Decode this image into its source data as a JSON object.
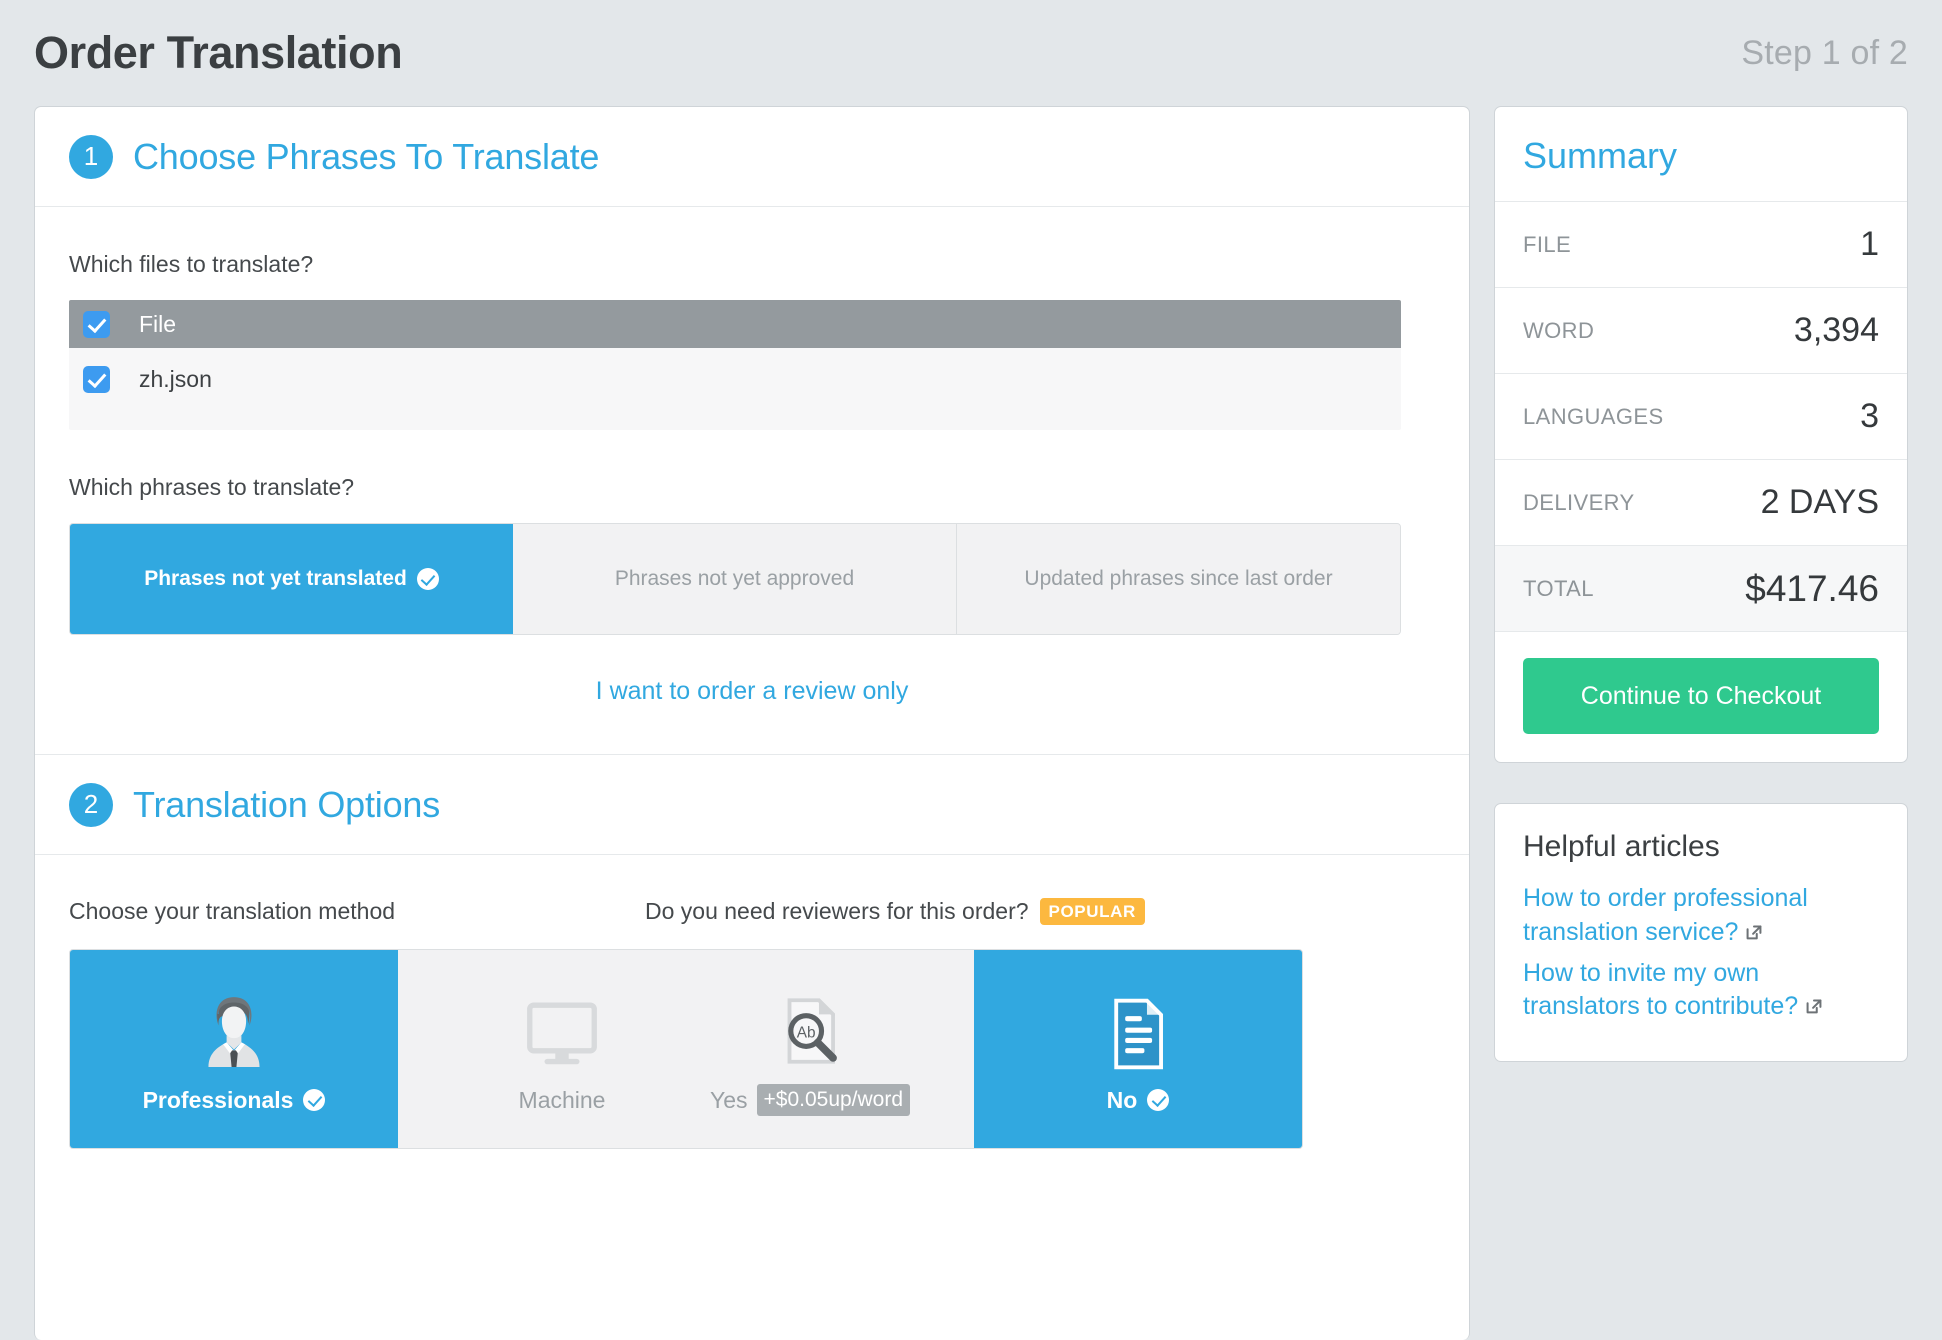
{
  "header": {
    "title": "Order Translation",
    "step": "Step 1 of 2"
  },
  "section1": {
    "number": "1",
    "title": "Choose Phrases To Translate",
    "files_label": "Which files to translate?",
    "file_list": {
      "header": "File",
      "items": [
        "zh.json"
      ]
    },
    "phrases_label": "Which phrases to translate?",
    "phrase_tabs": [
      {
        "label": "Phrases not yet translated",
        "selected": true
      },
      {
        "label": "Phrases not yet approved",
        "selected": false
      },
      {
        "label": "Updated phrases since last order",
        "selected": false
      }
    ],
    "review_link": "I want to order a review only"
  },
  "section2": {
    "number": "2",
    "title": "Translation Options",
    "method_question": "Choose your translation method",
    "method_tiles": [
      {
        "label": "Professionals",
        "icon": "businessperson-icon",
        "selected": true
      },
      {
        "label": "Machine",
        "icon": "monitor-icon",
        "selected": false
      }
    ],
    "reviewer_question": "Do you need reviewers for this order?",
    "reviewer_badge": "POPULAR",
    "reviewer_tiles": [
      {
        "label": "Yes",
        "price": "+$0.05up/word",
        "icon": "document-search-icon",
        "selected": false
      },
      {
        "label": "No",
        "price": "",
        "icon": "document-lines-icon",
        "selected": true
      }
    ]
  },
  "summary": {
    "title": "Summary",
    "rows": [
      {
        "key": "FILE",
        "value": "1"
      },
      {
        "key": "WORD",
        "value": "3,394"
      },
      {
        "key": "LANGUAGES",
        "value": "3"
      },
      {
        "key": "DELIVERY",
        "value": "2 DAYS"
      },
      {
        "key": "TOTAL",
        "value": "$417.46"
      }
    ],
    "checkout_label": "Continue to Checkout"
  },
  "articles": {
    "title": "Helpful articles",
    "links": [
      "How to order professional translation service?",
      "How to invite my own translators to contribute?"
    ]
  },
  "colors": {
    "accent_blue": "#31a8e0",
    "green": "#2fc98e",
    "orange": "#fcb83f",
    "page_bg": "#e3e7ea"
  }
}
